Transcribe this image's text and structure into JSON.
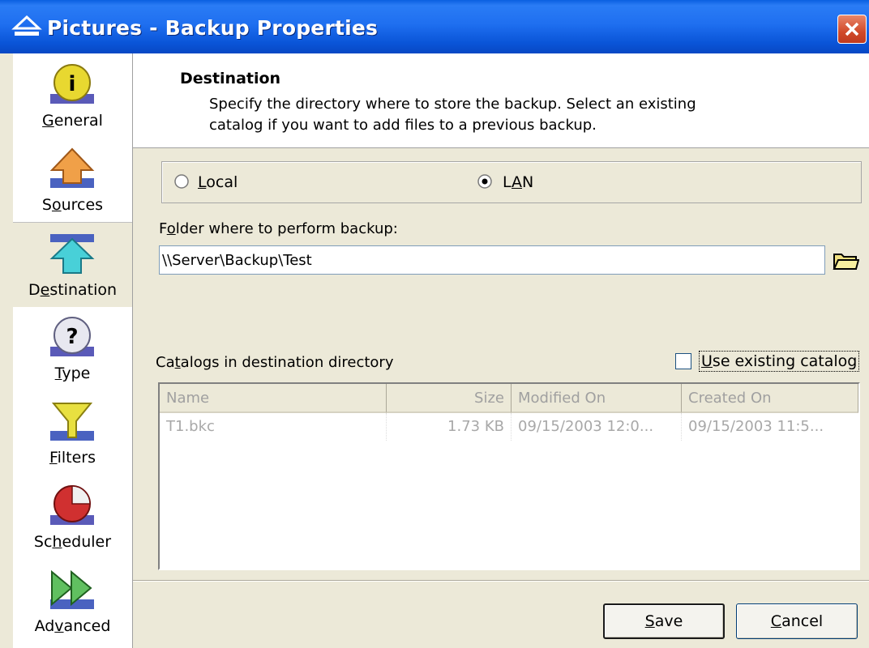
{
  "window": {
    "title": "Pictures - Backup Properties"
  },
  "sidebar": {
    "items": [
      {
        "pre": "",
        "accel": "G",
        "post": "eneral",
        "icon": "info-icon"
      },
      {
        "pre": "S",
        "accel": "o",
        "post": "urces",
        "icon": "arrow-up-orange-icon"
      },
      {
        "pre": "D",
        "accel": "e",
        "post": "stination",
        "icon": "arrow-up-teal-icon"
      },
      {
        "pre": "",
        "accel": "T",
        "post": "ype",
        "icon": "question-icon"
      },
      {
        "pre": "",
        "accel": "F",
        "post": "ilters",
        "icon": "funnel-icon"
      },
      {
        "pre": "Sc",
        "accel": "h",
        "post": "eduler",
        "icon": "pie-clock-icon"
      },
      {
        "pre": "Ad",
        "accel": "v",
        "post": "anced",
        "icon": "double-arrow-icon"
      }
    ],
    "selected": "Destination"
  },
  "header": {
    "title": "Destination",
    "description_line1": "Specify the directory where to store the backup. Select an existing",
    "description_line2": "catalog if you want to add files to a previous backup."
  },
  "location": {
    "local_accel": "L",
    "local_rest": "ocal",
    "lan_pre": "L",
    "lan_accel": "A",
    "lan_post": "N",
    "selected": "LAN"
  },
  "folder": {
    "label_pre": "F",
    "label_accel": "o",
    "label_post": "lder where to perform backup:",
    "value": "\\\\Server\\Backup\\Test"
  },
  "catalogs": {
    "label_pre": "Ca",
    "label_accel": "t",
    "label_post": "alogs in destination directory",
    "use_existing_accel": "U",
    "use_existing_rest": "se existing catalog",
    "use_existing_checked": false,
    "columns": [
      "Name",
      "Size",
      "Modified On",
      "Created On"
    ],
    "rows": [
      [
        "T1.bkc",
        "1.73 KB",
        "09/15/2003 12:0...",
        "09/15/2003 11:5..."
      ]
    ]
  },
  "buttons": {
    "save_accel": "S",
    "save_rest": "ave",
    "cancel_accel": "C",
    "cancel_rest": "ancel"
  },
  "colors": {
    "titlebar": "#0a55d8",
    "window_bg": "#ece9d8",
    "close_button": "#d14a2a",
    "disabled_text": "#a0a0a0"
  }
}
